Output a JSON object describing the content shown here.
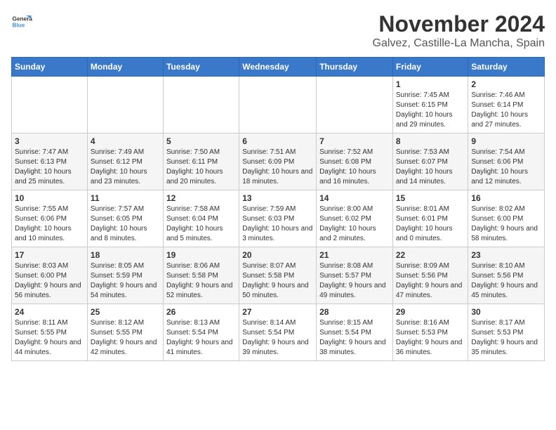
{
  "header": {
    "logo_general": "General",
    "logo_blue": "Blue",
    "title": "November 2024",
    "subtitle": "Galvez, Castille-La Mancha, Spain"
  },
  "calendar": {
    "days_of_week": [
      "Sunday",
      "Monday",
      "Tuesday",
      "Wednesday",
      "Thursday",
      "Friday",
      "Saturday"
    ],
    "weeks": [
      [
        {
          "day": "",
          "info": ""
        },
        {
          "day": "",
          "info": ""
        },
        {
          "day": "",
          "info": ""
        },
        {
          "day": "",
          "info": ""
        },
        {
          "day": "",
          "info": ""
        },
        {
          "day": "1",
          "info": "Sunrise: 7:45 AM\nSunset: 6:15 PM\nDaylight: 10 hours and 29 minutes."
        },
        {
          "day": "2",
          "info": "Sunrise: 7:46 AM\nSunset: 6:14 PM\nDaylight: 10 hours and 27 minutes."
        }
      ],
      [
        {
          "day": "3",
          "info": "Sunrise: 7:47 AM\nSunset: 6:13 PM\nDaylight: 10 hours and 25 minutes."
        },
        {
          "day": "4",
          "info": "Sunrise: 7:49 AM\nSunset: 6:12 PM\nDaylight: 10 hours and 23 minutes."
        },
        {
          "day": "5",
          "info": "Sunrise: 7:50 AM\nSunset: 6:11 PM\nDaylight: 10 hours and 20 minutes."
        },
        {
          "day": "6",
          "info": "Sunrise: 7:51 AM\nSunset: 6:09 PM\nDaylight: 10 hours and 18 minutes."
        },
        {
          "day": "7",
          "info": "Sunrise: 7:52 AM\nSunset: 6:08 PM\nDaylight: 10 hours and 16 minutes."
        },
        {
          "day": "8",
          "info": "Sunrise: 7:53 AM\nSunset: 6:07 PM\nDaylight: 10 hours and 14 minutes."
        },
        {
          "day": "9",
          "info": "Sunrise: 7:54 AM\nSunset: 6:06 PM\nDaylight: 10 hours and 12 minutes."
        }
      ],
      [
        {
          "day": "10",
          "info": "Sunrise: 7:55 AM\nSunset: 6:06 PM\nDaylight: 10 hours and 10 minutes."
        },
        {
          "day": "11",
          "info": "Sunrise: 7:57 AM\nSunset: 6:05 PM\nDaylight: 10 hours and 8 minutes."
        },
        {
          "day": "12",
          "info": "Sunrise: 7:58 AM\nSunset: 6:04 PM\nDaylight: 10 hours and 5 minutes."
        },
        {
          "day": "13",
          "info": "Sunrise: 7:59 AM\nSunset: 6:03 PM\nDaylight: 10 hours and 3 minutes."
        },
        {
          "day": "14",
          "info": "Sunrise: 8:00 AM\nSunset: 6:02 PM\nDaylight: 10 hours and 2 minutes."
        },
        {
          "day": "15",
          "info": "Sunrise: 8:01 AM\nSunset: 6:01 PM\nDaylight: 10 hours and 0 minutes."
        },
        {
          "day": "16",
          "info": "Sunrise: 8:02 AM\nSunset: 6:00 PM\nDaylight: 9 hours and 58 minutes."
        }
      ],
      [
        {
          "day": "17",
          "info": "Sunrise: 8:03 AM\nSunset: 6:00 PM\nDaylight: 9 hours and 56 minutes."
        },
        {
          "day": "18",
          "info": "Sunrise: 8:05 AM\nSunset: 5:59 PM\nDaylight: 9 hours and 54 minutes."
        },
        {
          "day": "19",
          "info": "Sunrise: 8:06 AM\nSunset: 5:58 PM\nDaylight: 9 hours and 52 minutes."
        },
        {
          "day": "20",
          "info": "Sunrise: 8:07 AM\nSunset: 5:58 PM\nDaylight: 9 hours and 50 minutes."
        },
        {
          "day": "21",
          "info": "Sunrise: 8:08 AM\nSunset: 5:57 PM\nDaylight: 9 hours and 49 minutes."
        },
        {
          "day": "22",
          "info": "Sunrise: 8:09 AM\nSunset: 5:56 PM\nDaylight: 9 hours and 47 minutes."
        },
        {
          "day": "23",
          "info": "Sunrise: 8:10 AM\nSunset: 5:56 PM\nDaylight: 9 hours and 45 minutes."
        }
      ],
      [
        {
          "day": "24",
          "info": "Sunrise: 8:11 AM\nSunset: 5:55 PM\nDaylight: 9 hours and 44 minutes."
        },
        {
          "day": "25",
          "info": "Sunrise: 8:12 AM\nSunset: 5:55 PM\nDaylight: 9 hours and 42 minutes."
        },
        {
          "day": "26",
          "info": "Sunrise: 8:13 AM\nSunset: 5:54 PM\nDaylight: 9 hours and 41 minutes."
        },
        {
          "day": "27",
          "info": "Sunrise: 8:14 AM\nSunset: 5:54 PM\nDaylight: 9 hours and 39 minutes."
        },
        {
          "day": "28",
          "info": "Sunrise: 8:15 AM\nSunset: 5:54 PM\nDaylight: 9 hours and 38 minutes."
        },
        {
          "day": "29",
          "info": "Sunrise: 8:16 AM\nSunset: 5:53 PM\nDaylight: 9 hours and 36 minutes."
        },
        {
          "day": "30",
          "info": "Sunrise: 8:17 AM\nSunset: 5:53 PM\nDaylight: 9 hours and 35 minutes."
        }
      ]
    ]
  }
}
